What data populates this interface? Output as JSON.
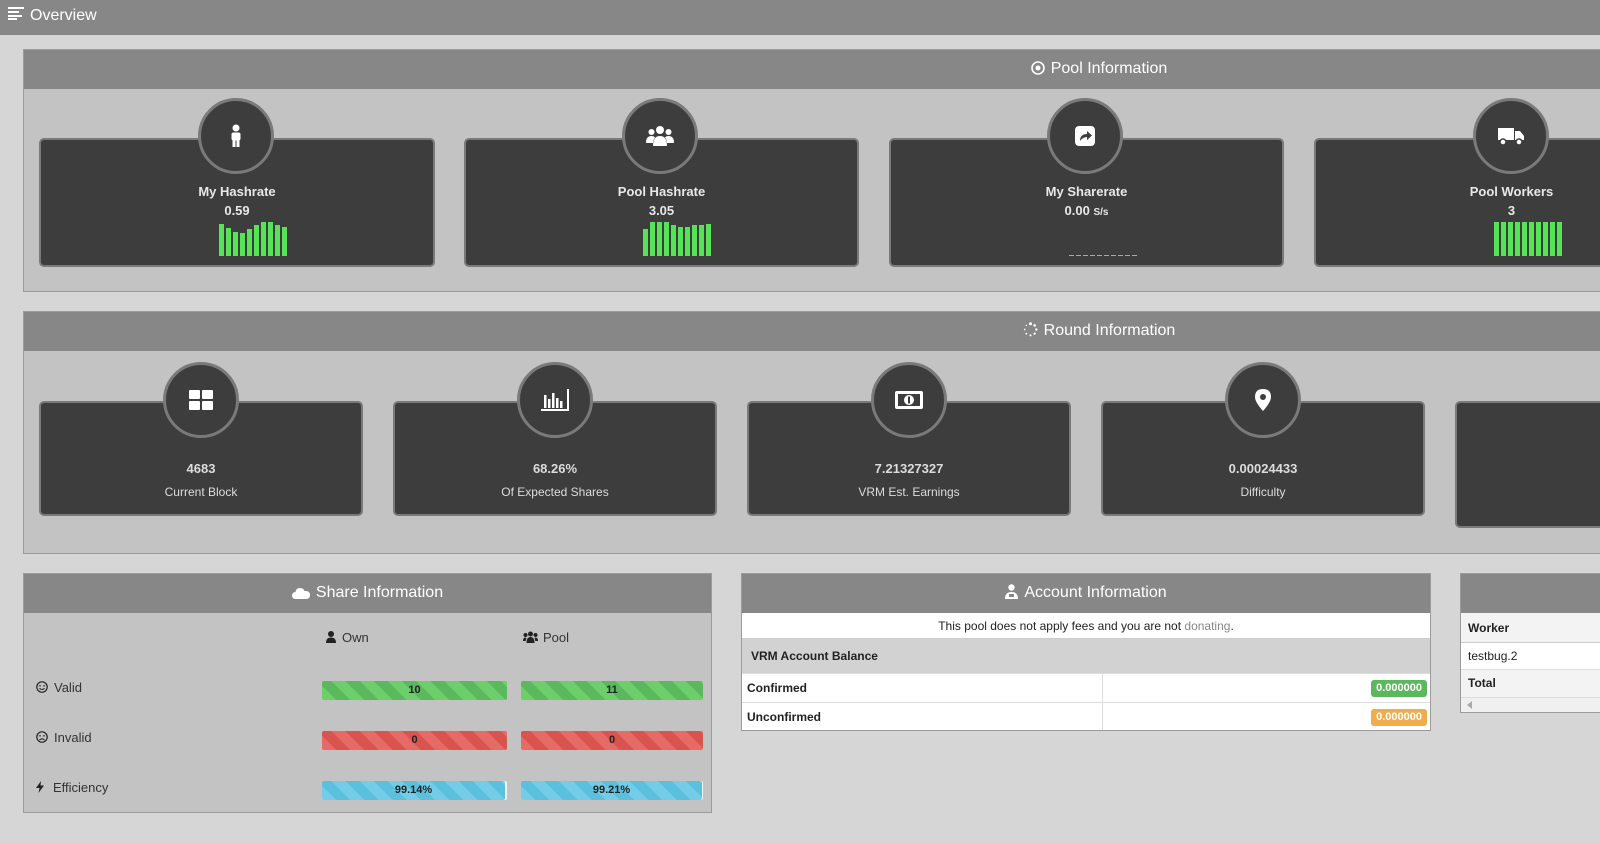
{
  "topbar": {
    "title": "Overview"
  },
  "pool_info": {
    "title": "Pool Information",
    "cards": [
      {
        "title": "My Hashrate",
        "value": "0.59",
        "unit": "",
        "icon": "user-icon",
        "spark": [
          0.95,
          0.82,
          0.7,
          0.68,
          0.8,
          0.92,
          1.0,
          1.0,
          0.92,
          0.85
        ]
      },
      {
        "title": "Pool Hashrate",
        "value": "3.05",
        "unit": "",
        "icon": "users-icon",
        "spark": [
          0.78,
          1.0,
          1.0,
          1.0,
          0.9,
          0.85,
          0.85,
          0.9,
          0.9,
          0.95
        ]
      },
      {
        "title": "My Sharerate",
        "value": "0.00",
        "unit": "S/s",
        "icon": "share-icon",
        "spark": [
          0.04,
          0.04,
          0.04,
          0.04,
          0.04,
          0.04,
          0.04,
          0.04,
          0.04,
          0.04
        ]
      },
      {
        "title": "Pool Workers",
        "value": "3",
        "unit": "",
        "icon": "truck-icon",
        "spark": [
          1.0,
          1.0,
          1.0,
          1.0,
          1.0,
          1.0,
          1.0,
          1.0,
          1.0,
          1.0
        ]
      }
    ]
  },
  "round_info": {
    "title": "Round Information",
    "cards": [
      {
        "value": "4683",
        "label": "Current Block",
        "icon": "blocks-icon"
      },
      {
        "value": "68.26%",
        "label": "Of Expected Shares",
        "icon": "bar-chart-icon"
      },
      {
        "value": "7.21327327",
        "label": "VRM Est. Earnings",
        "icon": "money-icon"
      },
      {
        "value": "0.00024433",
        "label": "Difficulty",
        "icon": "map-marker-icon"
      }
    ]
  },
  "share_info": {
    "title": "Share Information",
    "col_own": "Own",
    "col_pool": "Pool",
    "rows": [
      {
        "label": "Valid",
        "icon": "smile-icon",
        "own": "10",
        "pool": "11",
        "color": "green",
        "own_fill": 1.0,
        "pool_fill": 1.0
      },
      {
        "label": "Invalid",
        "icon": "frown-icon",
        "own": "0",
        "pool": "0",
        "color": "red",
        "own_fill": 1.0,
        "pool_fill": 1.0
      },
      {
        "label": "Efficiency",
        "icon": "bolt-icon",
        "own": "99.14%",
        "pool": "99.21%",
        "color": "blue",
        "own_fill": 0.9914,
        "pool_fill": 0.9921
      }
    ]
  },
  "account_info": {
    "title": "Account Information",
    "note": "This pool does not apply fees and you are not ",
    "note_link": "donating",
    "note_end": ".",
    "balance_heading": "VRM Account Balance",
    "confirmed_label": "Confirmed",
    "confirmed_value": "0.000000",
    "unconfirmed_label": "Unconfirmed",
    "unconfirmed_value": "0.000000"
  },
  "workers": {
    "header": "Worker",
    "rows": [
      "testbug.2"
    ],
    "total_label": "Total"
  },
  "colors": {
    "sparkline": "#55e455",
    "confirmed": "#5cb85c",
    "unconfirmed": "#f0ad4e"
  }
}
